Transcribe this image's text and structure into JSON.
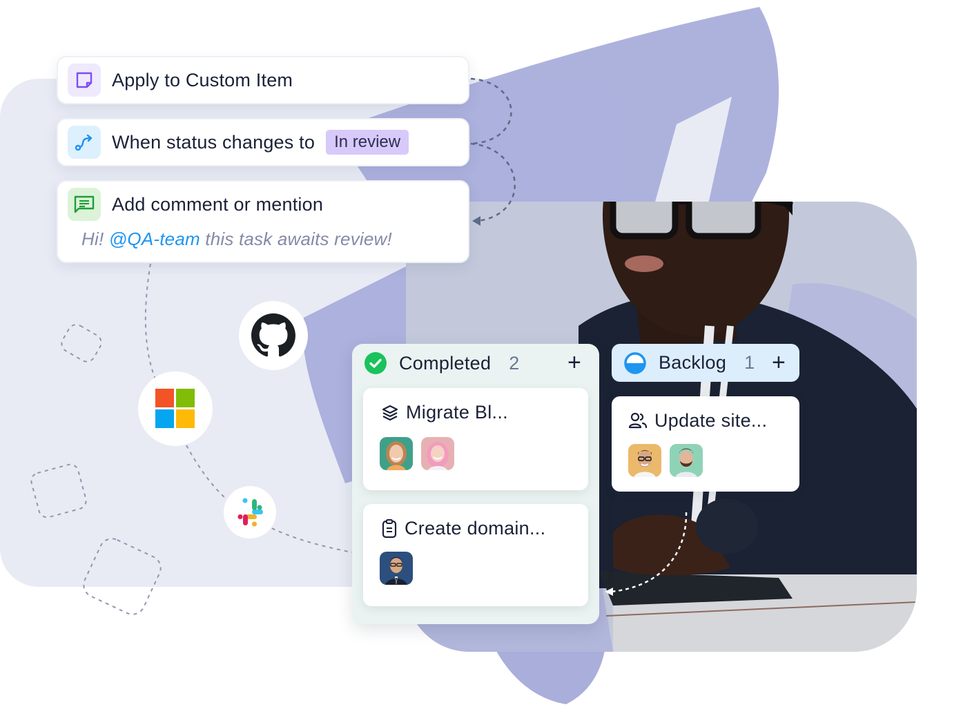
{
  "automation": {
    "apply_card": {
      "icon": "sticky-note-icon",
      "label": "Apply to Custom Item"
    },
    "trigger_card": {
      "icon": "route-arrow-icon",
      "label": "When status changes to",
      "status_badge": "In review"
    },
    "action_card": {
      "icon": "comment-icon",
      "label": "Add comment or mention",
      "comment": {
        "prefix": "Hi! ",
        "mention": "@QA-team",
        "suffix": " this task awaits review!"
      }
    }
  },
  "integrations": [
    {
      "name": "GitHub",
      "icon": "github-icon"
    },
    {
      "name": "Microsoft",
      "icon": "microsoft-icon"
    },
    {
      "name": "Slack",
      "icon": "slack-icon"
    }
  ],
  "board": {
    "columns": [
      {
        "title": "Completed",
        "count": "2",
        "status_icon": "check-circle-icon",
        "add_label": "+",
        "tasks": [
          {
            "icon": "layers-icon",
            "title": "Migrate Bl...",
            "assignees": [
              "Woman with auburn hair",
              "Woman with pink hair"
            ]
          },
          {
            "icon": "clipboard-icon",
            "title": "Create domain...",
            "assignees": [
              "Man in suit with glasses"
            ]
          }
        ]
      },
      {
        "title": "Backlog",
        "count": "1",
        "status_icon": "half-circle-icon",
        "add_label": "+",
        "tasks": [
          {
            "icon": "users-icon",
            "title": "Update site...",
            "assignees": [
              "Man with glasses",
              "Man with beard"
            ]
          }
        ]
      }
    ]
  },
  "colors": {
    "accent_purple": "#7b4ff0",
    "accent_blue": "#1e95f0",
    "accent_green": "#1f9d3a",
    "completed_green": "#19c35c",
    "badge_purple": "#d8c9fb",
    "brush_lavender": "#a9aedb"
  }
}
